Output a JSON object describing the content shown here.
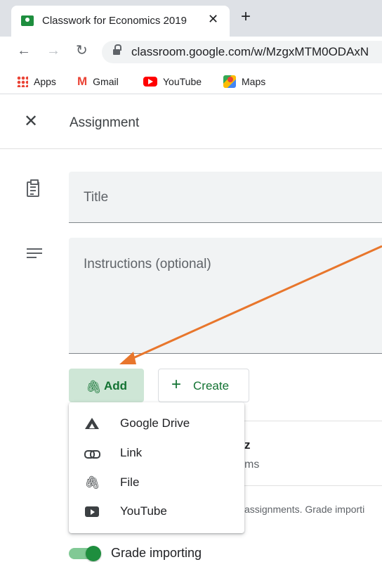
{
  "browser": {
    "tab_title": "Classwork for Economics 2019",
    "tab_close": "✕",
    "new_tab": "+",
    "url": "classroom.google.com/w/MzgxMTM0ODAxN",
    "bookmarks": [
      {
        "label": "Apps",
        "icon": "apps-grid-icon"
      },
      {
        "label": "Gmail",
        "icon": "gmail-icon"
      },
      {
        "label": "YouTube",
        "icon": "youtube-icon"
      },
      {
        "label": "Maps",
        "icon": "maps-icon"
      }
    ]
  },
  "header": {
    "close": "✕",
    "title": "Assignment"
  },
  "form": {
    "title_placeholder": "Title",
    "instructions_placeholder": "Instructions (optional)",
    "add_label": "Add",
    "create_label": "Create"
  },
  "attach_menu": {
    "items": [
      {
        "label": "Google Drive",
        "icon": "google-drive-icon"
      },
      {
        "label": "Link",
        "icon": "link-icon"
      },
      {
        "label": "File",
        "icon": "paperclip-icon"
      },
      {
        "label": "YouTube",
        "icon": "youtube-icon"
      }
    ]
  },
  "background": {
    "partial_z": "z",
    "partial_ms": "ms",
    "partial_note": "assignments. Grade importi"
  },
  "grade_importing": {
    "label": "Grade importing",
    "enabled": true
  },
  "colors": {
    "accent_green": "#137333",
    "add_button_bg": "#cee6d6",
    "toggle_green": "#1e8e3e",
    "annotation_arrow": "#e8762c"
  }
}
